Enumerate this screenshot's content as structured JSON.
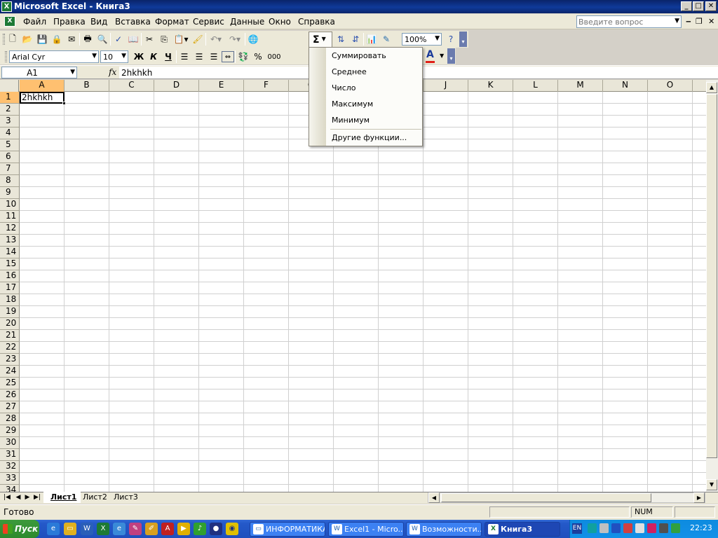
{
  "window": {
    "title": "Microsoft Excel - Книга3",
    "app_icon": "X",
    "minimize": "_",
    "maximize": "□",
    "close": "✕"
  },
  "menu": {
    "items": [
      "Файл",
      "Правка",
      "Вид",
      "Вставка",
      "Формат",
      "Сервис",
      "Данные",
      "Окно",
      "Справка"
    ],
    "help_placeholder": "Введите вопрос",
    "doc_icon": "X"
  },
  "toolbar": {
    "zoom": "100%",
    "sigma": "Σ",
    "font_name": "Arial Cyr",
    "font_size": "10",
    "bold": "Ж",
    "italic": "К",
    "underline": "Ч",
    "percent": "%",
    "thousands": "000",
    "font_color_letter": "A",
    "accent_red": "#e0201a"
  },
  "formula_bar": {
    "name_box": "A1",
    "fx": "fx",
    "content": "2hkhkh"
  },
  "grid": {
    "columns": [
      "A",
      "B",
      "C",
      "D",
      "E",
      "F",
      "G",
      "H",
      "I",
      "J",
      "K",
      "L",
      "M",
      "N",
      "O"
    ],
    "rows": [
      "1",
      "2",
      "3",
      "4",
      "5",
      "6",
      "7",
      "8",
      "9",
      "10",
      "11",
      "12",
      "13",
      "14",
      "15",
      "16",
      "17",
      "18",
      "19",
      "20",
      "21",
      "22",
      "23",
      "24",
      "25",
      "26",
      "27",
      "28",
      "29",
      "30",
      "31",
      "32",
      "33",
      "34"
    ],
    "selected_cell": "A1",
    "a1_value": "2hkhkh"
  },
  "autosum_menu": {
    "items": [
      "Суммировать",
      "Среднее",
      "Число",
      "Максимум",
      "Минимум"
    ],
    "more": "Другие функции..."
  },
  "sheets": {
    "tabs": [
      "Лист1",
      "Лист2",
      "Лист3"
    ],
    "active": "Лист1"
  },
  "status": {
    "ready": "Готово",
    "num": "NUM"
  },
  "taskbar": {
    "start": "Пуск",
    "buttons": [
      "ИНФОРМАТИКА",
      "Excel1 - Micro...",
      "Возможности...",
      "Книга3"
    ],
    "active": "Книга3",
    "lang": "EN",
    "clock": "22:23"
  }
}
